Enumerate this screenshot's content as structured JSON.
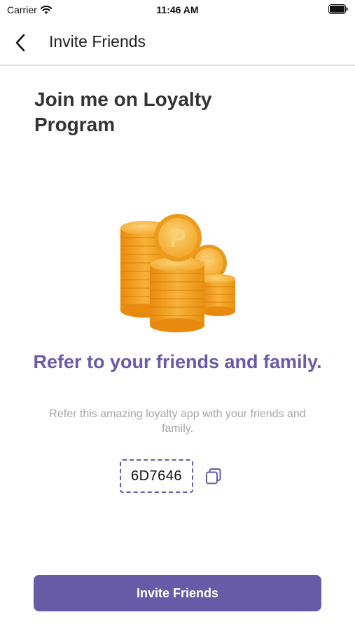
{
  "status_bar": {
    "carrier": "Carrier",
    "time": "11:46 AM",
    "wifi_icon": "wifi-icon",
    "battery_icon": "battery-icon"
  },
  "nav": {
    "back_icon": "chevron-left-icon",
    "title": "Invite Friends"
  },
  "heading": "Join me on Loyalty Program",
  "illustration": {
    "icon": "coin-stack-icon",
    "coin_letter": "P"
  },
  "referral": {
    "title": "Refer to your friends and family.",
    "description": "Refer this amazing loyalty app with your friends and family.",
    "code": "6D7646",
    "copy_icon": "copy-icon"
  },
  "invite_button_label": "Invite Friends",
  "colors": {
    "accent": "#675ba8",
    "title_purple": "#6a5aa9",
    "coin_gold": "#f5a623",
    "muted_text": "#a6a6a6"
  }
}
